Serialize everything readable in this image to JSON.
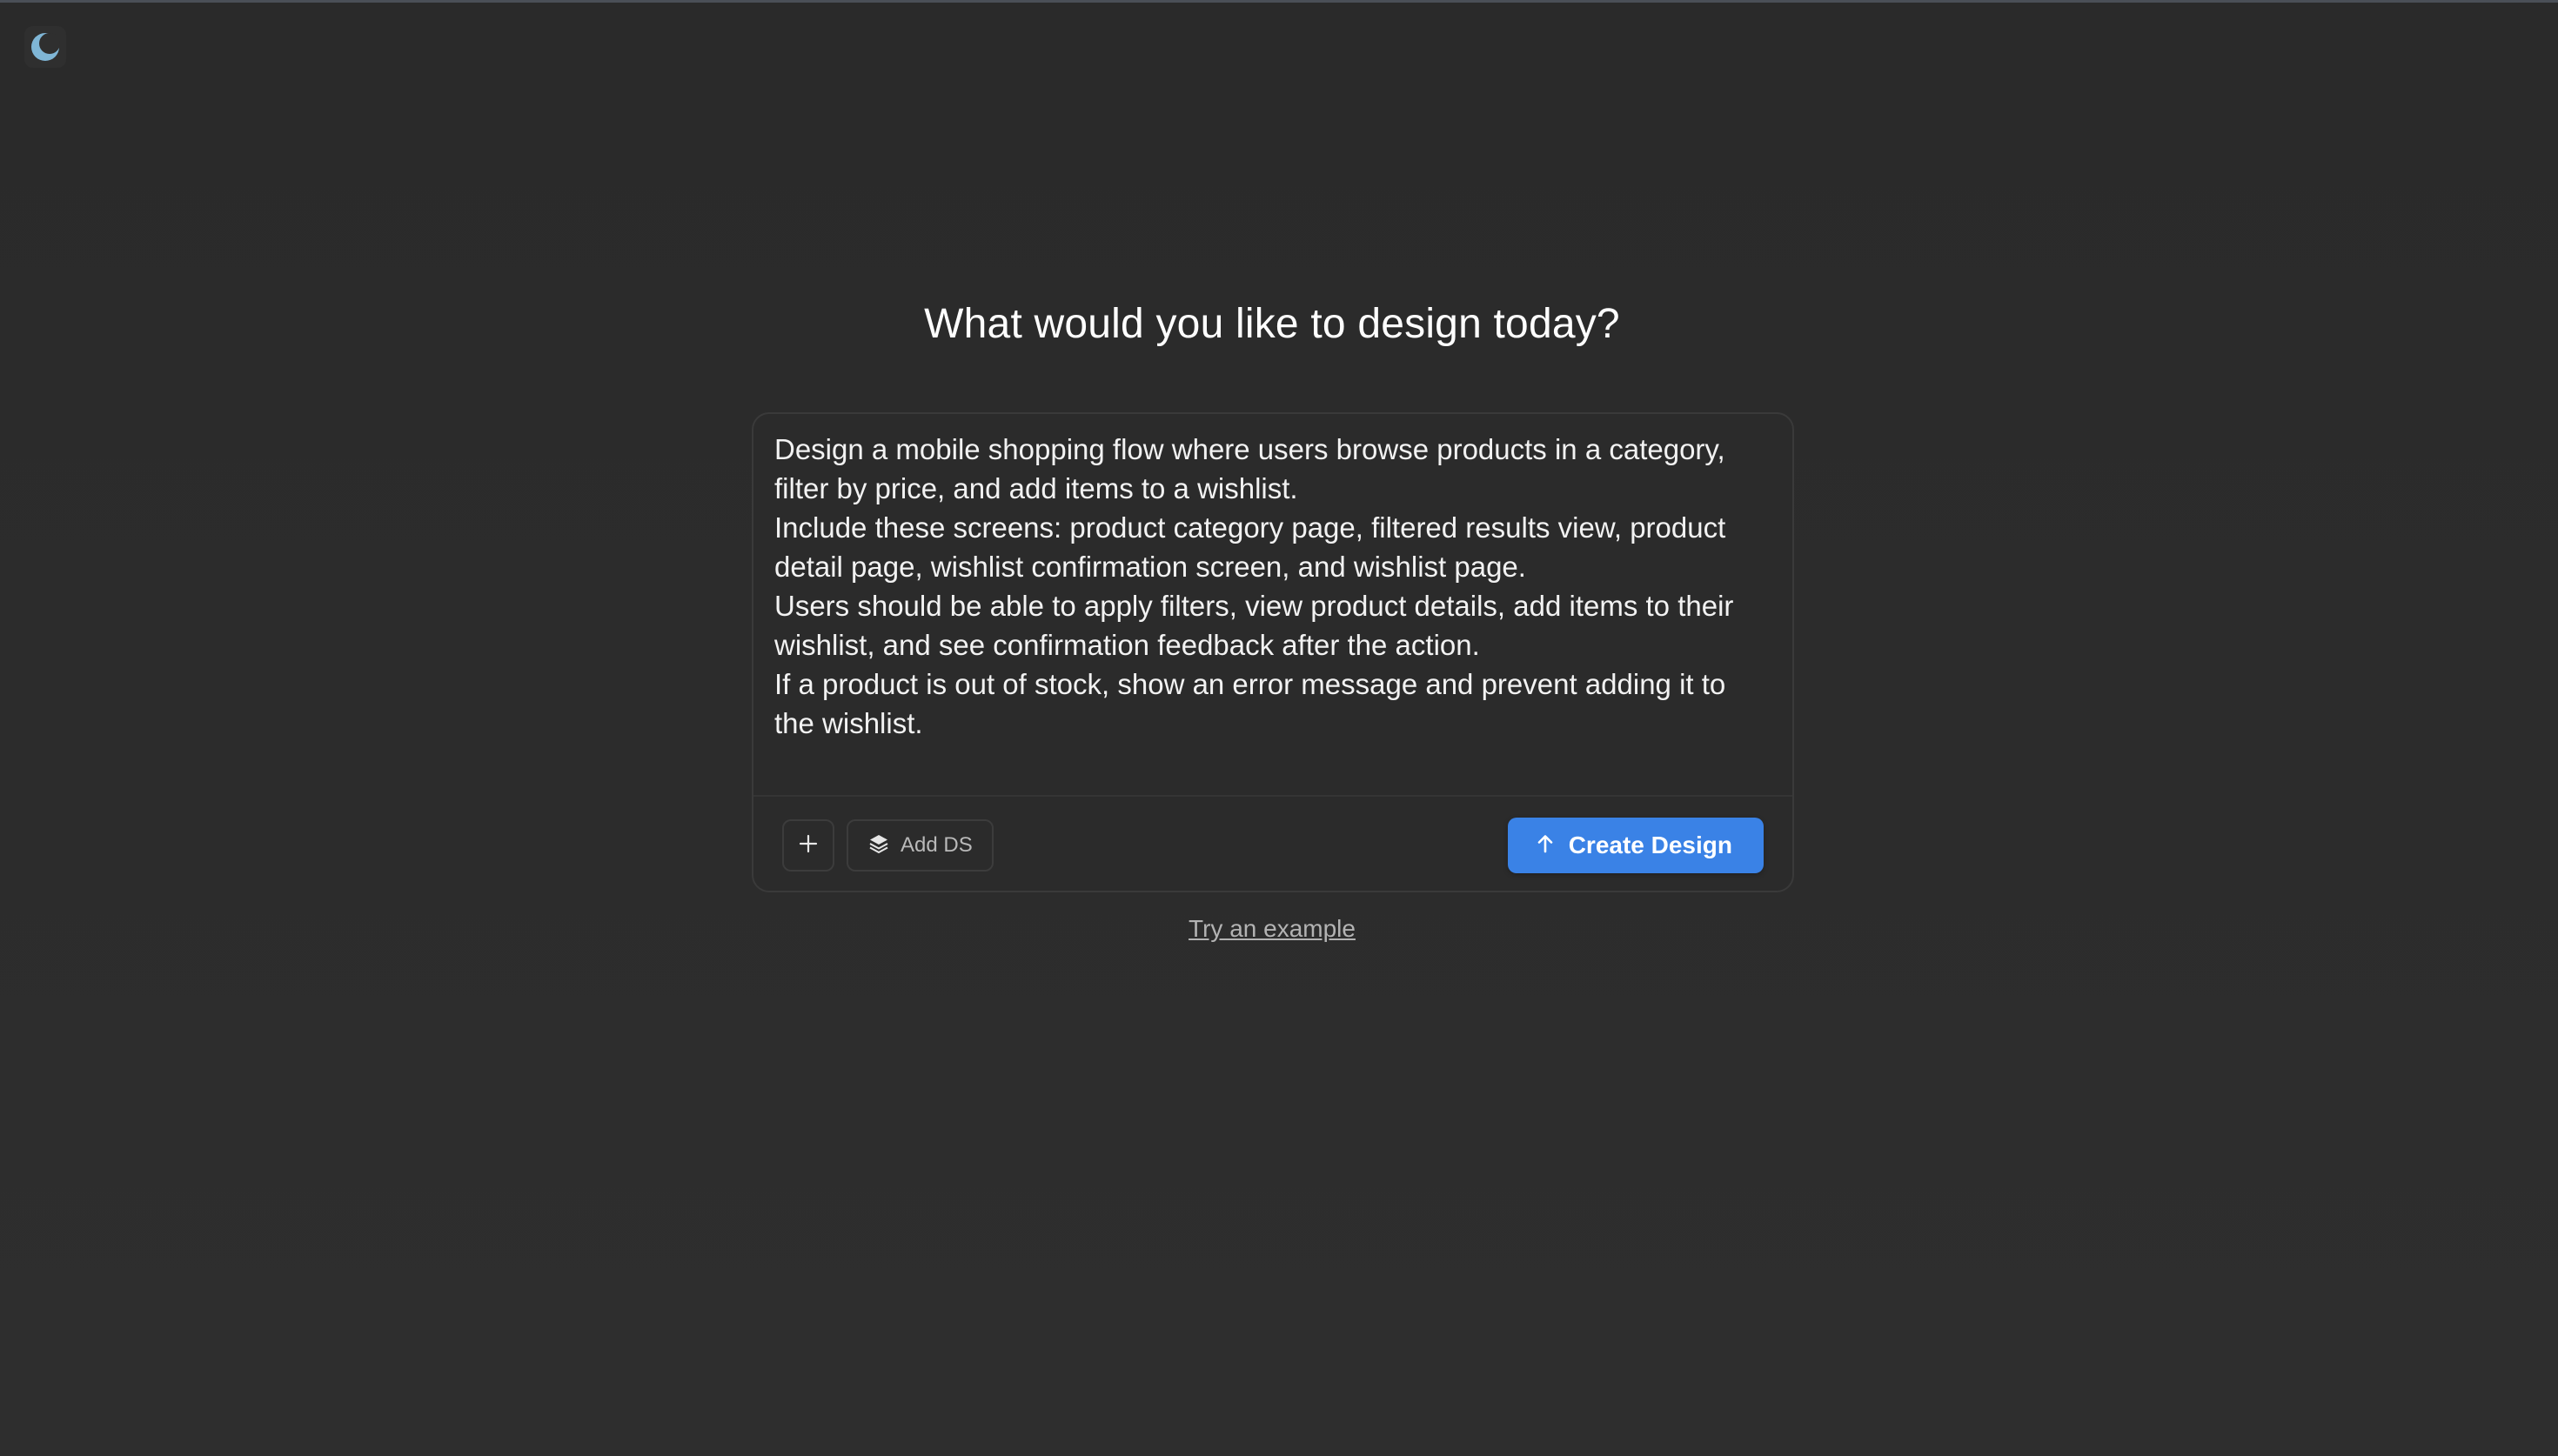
{
  "header": {
    "theme_toggle_icon": "moon-icon",
    "accent_color": "#7fb6d6"
  },
  "main": {
    "heading": "What would you like to design today?",
    "prompt": {
      "value": "Design a mobile shopping flow where users browse products in a category, filter by price, and add items to a wishlist.\nInclude these screens: product category page, filtered results view, product detail page, wishlist confirmation screen, and wishlist page.\nUsers should be able to apply filters, view product details, add items to their wishlist, and see confirmation feedback after the action.\nIf a product is out of stock, show an error message and prevent adding it to the wishlist."
    },
    "toolbar": {
      "attach_icon": "plus-icon",
      "add_ds_icon": "layers-icon",
      "add_ds_label": "Add DS",
      "create_icon": "arrow-up-icon",
      "create_label": "Create Design",
      "create_color": "#3a82e6"
    },
    "try_example_label": "Try an example"
  }
}
